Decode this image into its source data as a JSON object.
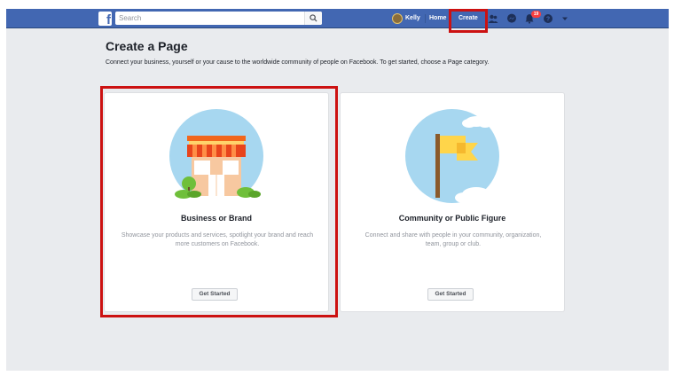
{
  "topbar": {
    "logo": "f",
    "search_placeholder": "Search",
    "user_name": "Kelly",
    "home": "Home",
    "create": "Create",
    "notification_count": "19",
    "bar_color": "#4267b2"
  },
  "page": {
    "title": "Create a Page",
    "description": "Connect your business, yourself or your cause to the worldwide community of people on Facebook. To get started, choose a Page category."
  },
  "cards": [
    {
      "title": "Business or Brand",
      "description": "Showcase your products and services, spotlight your brand and reach more customers on Facebook.",
      "button": "Get Started",
      "icon": "storefront-icon"
    },
    {
      "title": "Community or Public Figure",
      "description": "Connect and share with people in your community, organization, team, group or club.",
      "button": "Get Started",
      "icon": "flag-icon"
    }
  ],
  "highlight_color": "#cc1111"
}
